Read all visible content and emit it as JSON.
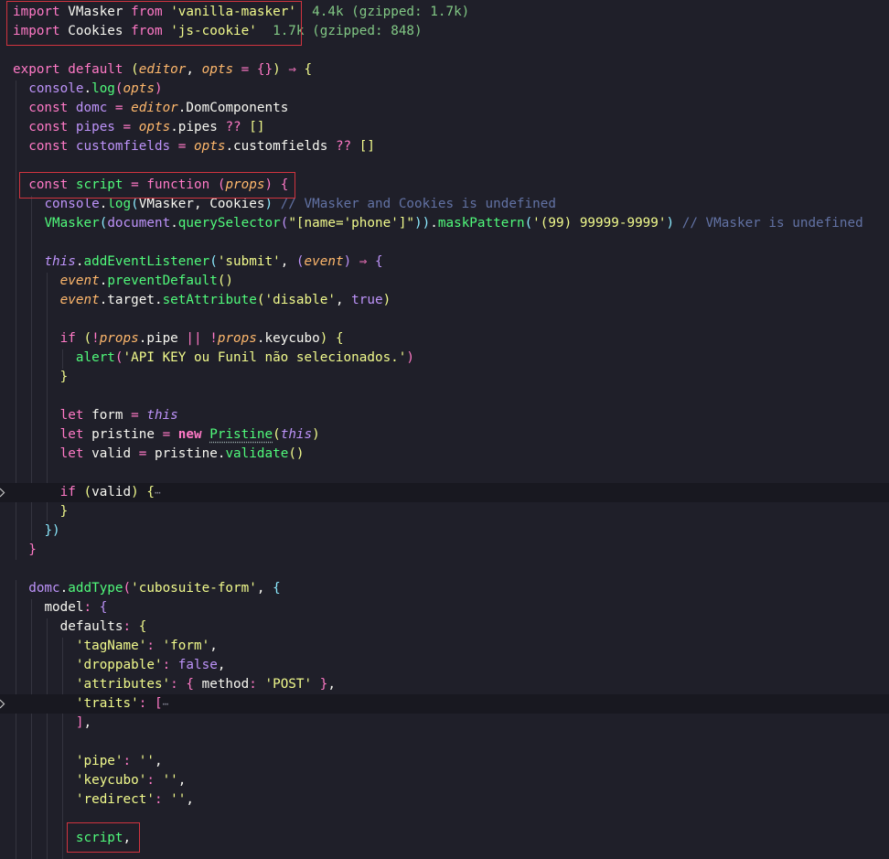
{
  "code": {
    "l1": {
      "kw1": "import",
      "name": "VMasker",
      "kw2": "from",
      "str": "'vanilla-masker'",
      "hint": "4.4k (gzipped: 1.7k)"
    },
    "l2": {
      "kw1": "import",
      "name": "Cookies",
      "kw2": "from",
      "str": "'js-cookie'",
      "hint": "1.7k (gzipped: 848)"
    },
    "l4": {
      "kw1": "export",
      "kw2": "default",
      "p1": "(",
      "a1": "editor",
      "comma": ",",
      "a2": "opts",
      "eq": "=",
      "obj": "{}",
      "p2": ")",
      "arrow": "⇒",
      "brace": "{"
    },
    "l5": {
      "obj": "console",
      "dot": ".",
      "fn": "log",
      "p1": "(",
      "arg": "opts",
      "p2": ")"
    },
    "l6": {
      "kw": "const",
      "name": "domc",
      "eq": "=",
      "obj": "editor",
      "prop": ".DomComponents"
    },
    "l7": {
      "kw": "const",
      "name": "pipes",
      "eq": "=",
      "obj": "opts",
      "prop": ".pipes",
      "op": "??",
      "arr": "[]"
    },
    "l8": {
      "kw": "const",
      "name": "customfields",
      "eq": "=",
      "obj": "opts",
      "prop": ".customfields",
      "op": "??",
      "arr": "[]"
    },
    "l10": {
      "kw": "const",
      "name": "script",
      "eq": "=",
      "fnkw": "function",
      "p1": "(",
      "arg": "props",
      "p2": ")",
      "brace": "{"
    },
    "l11": {
      "obj": "console",
      "dot": ".",
      "fn": "log",
      "p1": "(",
      "args": "VMasker, Cookies",
      "p2": ")",
      "comment": "// VMasker and Cookies is undefined"
    },
    "l12": {
      "fn": "VMasker",
      "p1": "(",
      "doc": "document",
      "dot": ".",
      "qs": "querySelector",
      "p2": "(",
      "str": "\"[name='phone']\"",
      "p3": "))",
      "dot2": ".",
      "mp": "maskPattern",
      "p4": "(",
      "str2": "'(99) 99999-9999'",
      "p5": ")",
      "comment": "// VMasker is undefined"
    },
    "l14": {
      "this": "this",
      "dot": ".",
      "fn": "addEventListener",
      "p1": "(",
      "str": "'submit'",
      "comma": ",",
      "p2": "(",
      "arg": "event",
      "p3": ")",
      "arrow": "⇒",
      "brace": "{"
    },
    "l15": {
      "obj": "event",
      "dot": ".",
      "fn": "preventDefault",
      "p": "()"
    },
    "l16": {
      "obj": "event",
      "prop": ".target.",
      "fn": "setAttribute",
      "p1": "(",
      "str": "'disable'",
      "comma": ",",
      "val": "true",
      "p2": ")"
    },
    "l18": {
      "kw": "if",
      "p1": "(",
      "not1": "!",
      "o1": "props",
      "prop1": ".pipe",
      "or": "||",
      "not2": "!",
      "o2": "props",
      "prop2": ".keycubo",
      "p2": ")",
      "brace": "{"
    },
    "l19": {
      "fn": "alert",
      "p1": "(",
      "str": "'API KEY ou Funil não selecionados.'",
      "p2": ")"
    },
    "l20": {
      "brace": "}"
    },
    "l22": {
      "kw": "let",
      "name": "form",
      "eq": "=",
      "this": "this"
    },
    "l23": {
      "kw": "let",
      "name": "pristine",
      "eq": "=",
      "newkw": "new",
      "cls": "Pristine",
      "p1": "(",
      "this": "this",
      "p2": ")"
    },
    "l24": {
      "kw": "let",
      "name": "valid",
      "eq": "=",
      "obj": "pristine",
      "dot": ".",
      "fn": "validate",
      "p": "()"
    },
    "l26": {
      "kw": "if",
      "p1": "(",
      "arg": "valid",
      "p2": ")",
      "brace": "{",
      "ell": "⋯"
    },
    "l27": {
      "brace": "}"
    },
    "l28": {
      "brace": "})"
    },
    "l29": {
      "brace": "}"
    },
    "l31": {
      "obj": "domc",
      "dot": ".",
      "fn": "addType",
      "p1": "(",
      "str": "'cubosuite-form'",
      "comma": ",",
      "brace": "{"
    },
    "l32": {
      "key": "model",
      "colon": ":",
      "brace": "{"
    },
    "l33": {
      "key": "defaults",
      "colon": ":",
      "brace": "{"
    },
    "l34": {
      "key": "'tagName'",
      "colon": ":",
      "val": "'form'",
      "comma": ","
    },
    "l35": {
      "key": "'droppable'",
      "colon": ":",
      "val": "false",
      "comma": ","
    },
    "l36": {
      "key": "'attributes'",
      "colon": ":",
      "b1": "{",
      "k": "method",
      "c": ":",
      "val": "'POST'",
      "b2": "}",
      "comma": ","
    },
    "l37": {
      "key": "'traits'",
      "colon": ":",
      "br": "[",
      "ell": "⋯"
    },
    "l38": {
      "br": "]",
      "comma": ","
    },
    "l40": {
      "key": "'pipe'",
      "colon": ":",
      "val": "''",
      "comma": ","
    },
    "l41": {
      "key": "'keycubo'",
      "colon": ":",
      "val": "''",
      "comma": ","
    },
    "l42": {
      "key": "'redirect'",
      "colon": ":",
      "val": "''",
      "comma": ","
    },
    "l44": {
      "name": "script",
      "comma": ","
    }
  },
  "colors": {
    "background": "#1f1f29",
    "keyword": "#ff79c6",
    "string": "#f1fa8c",
    "function": "#50fa7b",
    "variable": "#bd93f9",
    "parameter": "#ffb86c",
    "comment": "#6272a4",
    "highlight_box": "#d1343f"
  }
}
